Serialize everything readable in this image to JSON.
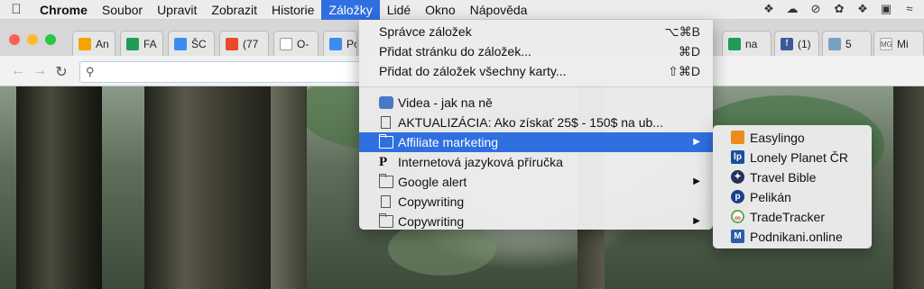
{
  "menubar": {
    "items": [
      "Chrome",
      "Soubor",
      "Upravit",
      "Zobrazit",
      "Historie",
      "Záložky",
      "Lidé",
      "Okno",
      "Nápověda"
    ]
  },
  "tabs": [
    {
      "label": "An",
      "icon": "google-analytics-icon",
      "color": "#f4a400"
    },
    {
      "label": "FA",
      "icon": "google-sheets-icon",
      "color": "#1e9d58"
    },
    {
      "label": "ŠC",
      "icon": "google-drive-icon",
      "color": "#3c8cf0"
    },
    {
      "label": "(77",
      "icon": "red-arrow-icon",
      "color": "#e84a2a"
    },
    {
      "label": "O-",
      "icon": "document-icon",
      "color": "#999999"
    },
    {
      "label": "Po",
      "icon": "google-drive-icon",
      "color": "#3c8cf0"
    },
    {
      "label": "na",
      "icon": "google-sheets-icon",
      "color": "#1e9d58"
    },
    {
      "label": "(1)",
      "icon": "facebook-icon",
      "color": "#3b5998"
    },
    {
      "label": "5 ",
      "icon": "photo-icon",
      "color": "#7aa0c0"
    },
    {
      "label": "Mi",
      "icon": "mg-icon",
      "color": "#555555"
    }
  ],
  "bookmarks_menu": {
    "top_items": [
      {
        "label": "Správce záložek",
        "shortcut": "⌥⌘B"
      },
      {
        "label": "Přidat stránku do záložek...",
        "shortcut": "⌘D"
      },
      {
        "label": "Přidat do záložek všechny karty...",
        "shortcut": "⇧⌘D"
      }
    ],
    "bookmarks": [
      {
        "label": "Videa - jak na ně",
        "icon": "video-bookmark-icon"
      },
      {
        "label": "AKTUALIZÁCIA: Ako získať 25$ - 150$ na ub...",
        "icon": "page-icon"
      },
      {
        "label": "Affiliate marketing",
        "icon": "folder-icon",
        "submenu": true
      },
      {
        "label": "Internetová jazyková příručka",
        "icon": "p-logo-icon"
      },
      {
        "label": "Google alert",
        "icon": "folder-icon",
        "submenu": true
      },
      {
        "label": "Copywriting",
        "icon": "page-icon"
      },
      {
        "label": "Copywriting",
        "icon": "folder-icon",
        "submenu": true
      }
    ],
    "arrow": "▶"
  },
  "affiliate_submenu": [
    {
      "label": "Easylingo",
      "icon": "easylingo-icon",
      "color": "#f08a1c"
    },
    {
      "label": "Lonely Planet ČR",
      "icon": "lonely-planet-icon",
      "color": "#1a4fa0"
    },
    {
      "label": "Travel Bible",
      "icon": "travel-bible-icon",
      "color": "#223355"
    },
    {
      "label": "Pelikán",
      "icon": "pelikan-icon",
      "color": "#1a3f8a"
    },
    {
      "label": "TradeTracker",
      "icon": "tradetracker-icon",
      "color": "#6aa84f"
    },
    {
      "label": "Podnikani.online",
      "icon": "podnikani-icon",
      "color": "#2a5caa"
    }
  ]
}
